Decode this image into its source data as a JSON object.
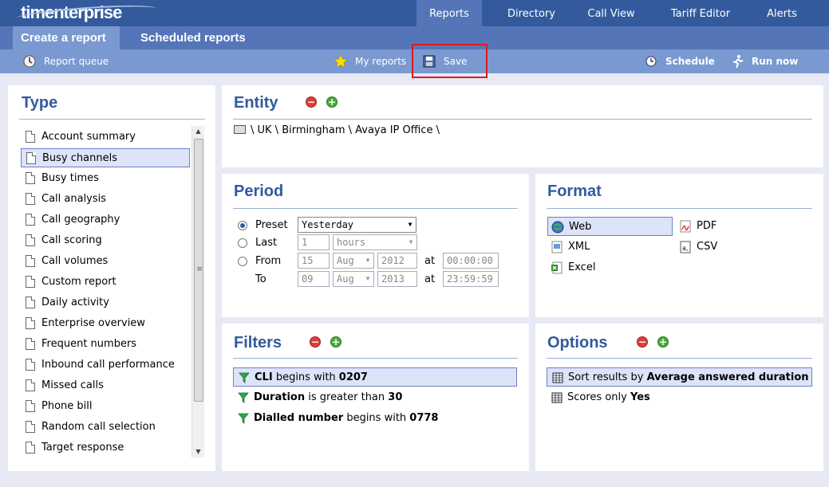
{
  "app": {
    "logo": "timenterprise"
  },
  "top_nav": [
    {
      "label": "Reports"
    },
    {
      "label": "Directory"
    },
    {
      "label": "Call View"
    },
    {
      "label": "Tariff Editor"
    },
    {
      "label": "Alerts"
    }
  ],
  "sub_nav": [
    {
      "label": "Create a report"
    },
    {
      "label": "Scheduled reports"
    }
  ],
  "toolbar": {
    "report_queue": "Report queue",
    "my_reports": "My reports",
    "save": "Save",
    "schedule": "Schedule",
    "run_now": "Run now"
  },
  "type_panel": {
    "title": "Type",
    "items": [
      "Account summary",
      "Busy channels",
      "Busy times",
      "Call analysis",
      "Call geography",
      "Call scoring",
      "Call volumes",
      "Custom report",
      "Daily activity",
      "Enterprise overview",
      "Frequent numbers",
      "Inbound call performance",
      "Missed calls",
      "Phone bill",
      "Random call selection",
      "Target response"
    ],
    "selected": "Busy channels"
  },
  "entity": {
    "title": "Entity",
    "path": "\\ UK \\ Birmingham \\ Avaya IP Office \\"
  },
  "period": {
    "title": "Period",
    "preset_label": "Preset",
    "preset_value": "Yesterday",
    "last_label": "Last",
    "last_count": "1",
    "last_unit": "hours",
    "from_label": "From",
    "to_label": "To",
    "at_label": "at",
    "from_day": "15",
    "from_month": "Aug",
    "from_year": "2012",
    "from_time": "00:00:00",
    "to_day": "09",
    "to_month": "Aug",
    "to_year": "2013",
    "to_time": "23:59:59"
  },
  "format": {
    "title": "Format",
    "web": "Web",
    "pdf": "PDF",
    "xml": "XML",
    "csv": "CSV",
    "excel": "Excel",
    "selected": "Web"
  },
  "filters": {
    "title": "Filters",
    "rows": [
      {
        "field": "CLI",
        "op": "begins with",
        "value": "0207"
      },
      {
        "field": "Duration",
        "op": "is greater than",
        "value": "30"
      },
      {
        "field": "Dialled number",
        "op": "begins with",
        "value": "0778"
      }
    ]
  },
  "options": {
    "title": "Options",
    "rows": [
      {
        "prefix": "Sort results by",
        "value": "Average answered duration"
      },
      {
        "prefix": "Scores only",
        "value": "Yes"
      }
    ]
  }
}
